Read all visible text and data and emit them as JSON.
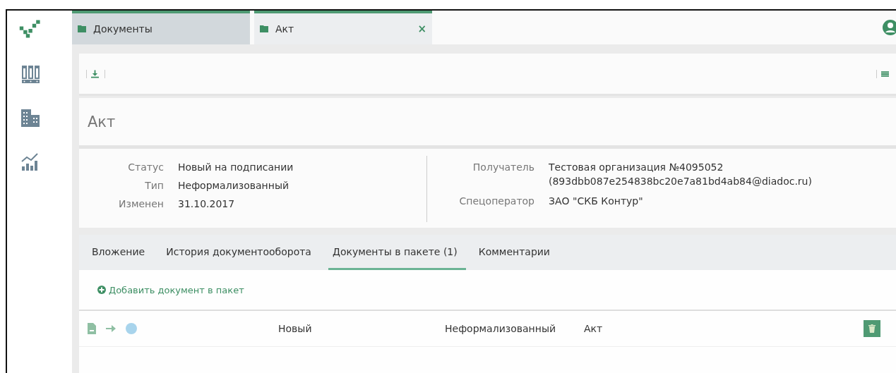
{
  "window_tabs": [
    {
      "label": "Документы",
      "selected": false
    },
    {
      "label": "Акт",
      "selected": true,
      "close": "×"
    }
  ],
  "document": {
    "title": "Акт"
  },
  "details_left": [
    {
      "label": "Статус",
      "value": "Новый на подписании"
    },
    {
      "label": "Тип",
      "value": "Неформализованный"
    },
    {
      "label": "Изменен",
      "value": "31.10.2017"
    }
  ],
  "details_right": [
    {
      "label": "Получатель",
      "value": "Тестовая организация №4095052",
      "value_2": "(893dbb087e254838bc20e7a81bd4ab84@diadoc.ru)"
    },
    {
      "label": "Спецоператор",
      "value": "ЗАО \"СКБ Контур\""
    }
  ],
  "section_tabs": [
    {
      "label": "Вложение",
      "selected": false
    },
    {
      "label": "История документооборота",
      "selected": false
    },
    {
      "label": "Документы в пакете (1)",
      "selected": true
    },
    {
      "label": "Комментарии",
      "selected": false
    }
  ],
  "add_link": "Добавить документ в пакет",
  "package_rows": [
    {
      "status": "Новый",
      "type": "Неформализованный",
      "name": "Акт",
      "color": "#a8d4ec"
    }
  ]
}
